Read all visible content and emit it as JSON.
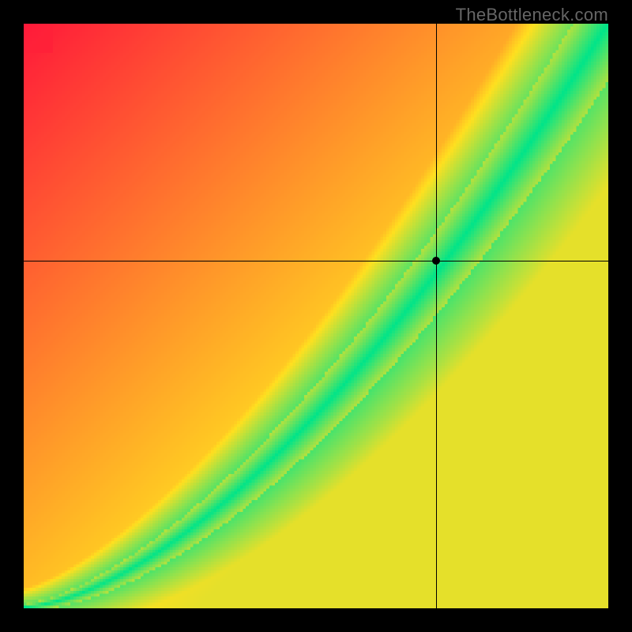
{
  "watermark": "TheBottleneck.com",
  "chart_data": {
    "type": "heatmap",
    "title": "",
    "xlabel": "",
    "ylabel": "",
    "xlim": [
      0,
      1
    ],
    "ylim": [
      0,
      1
    ],
    "colormap": "red-yellow-green",
    "color_stops": [
      {
        "t": 0.0,
        "color": "#ff1a3a"
      },
      {
        "t": 0.5,
        "color": "#ffe020"
      },
      {
        "t": 1.0,
        "color": "#00e58a"
      }
    ],
    "optimal_band": {
      "description": "Green band where GPU and CPU are balanced; y grows superlinearly with x",
      "curve_exponent": 1.6,
      "band_halfwidth_at_x0": 0.005,
      "band_halfwidth_at_x1": 0.1
    },
    "crosshair": {
      "x": 0.705,
      "y": 0.595
    },
    "marker": {
      "x": 0.705,
      "y": 0.595
    },
    "grid": false,
    "legend": false
  }
}
